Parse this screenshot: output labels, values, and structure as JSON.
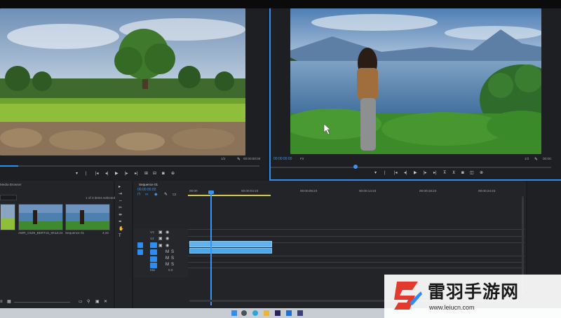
{
  "source_monitor": {
    "zoom": "1/2",
    "timecode": "00:00:00:00"
  },
  "program_monitor": {
    "timecode": "00:00:00:00",
    "fit_label": "Fit",
    "zoom": "1/2",
    "duration": "00:00:"
  },
  "media_browser": {
    "title": "Media Browser",
    "items_selected": "1 of 3 items selected",
    "items": [
      {
        "name": "AWR_C529_BERT15_00...",
        "duration": "13:24"
      },
      {
        "name": "Sequence 01",
        "duration": "4:22"
      }
    ]
  },
  "timeline": {
    "sequence_tab": "Sequence 01",
    "current_time": "00:00:00:00",
    "ruler": [
      "00:00",
      "00:00:04:23",
      "00:00:09:23",
      "00:00:14:23",
      "00:00:19:23",
      "00:00:24:23"
    ],
    "tracks": [
      "V3",
      "V2",
      "V1",
      "A1",
      "A2",
      "A3",
      "Mix"
    ],
    "mix_value": "0.0"
  },
  "watermark": {
    "title": "雷羽手游网",
    "url": "www.leiucn.com"
  },
  "colors": {
    "accent": "#2f8cf0",
    "clip": "#4ea8e8",
    "playhead": "#3a93f0",
    "work_area": "#d6c94a"
  }
}
